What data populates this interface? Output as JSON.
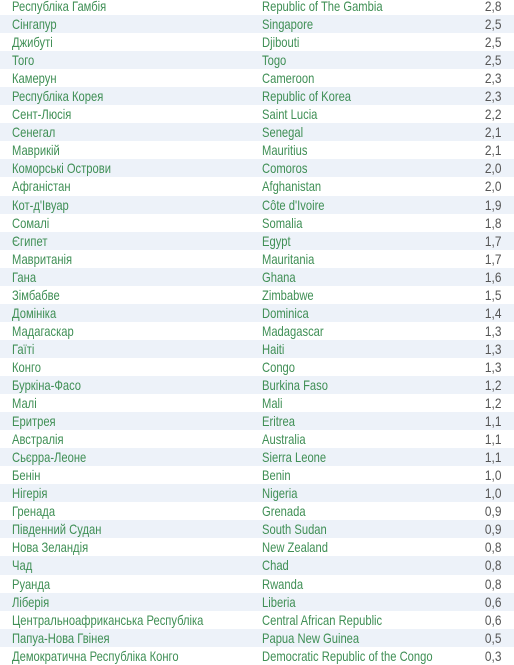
{
  "colors": {
    "text_green": "#3f8f55",
    "value_gray": "#555555",
    "stripe": "#edf2f9"
  },
  "rows": [
    {
      "uk": "Республіка Гамбія",
      "en": "Republic of The Gambia",
      "value": "2,8"
    },
    {
      "uk": "Сінгапур",
      "en": "Singapore",
      "value": "2,5"
    },
    {
      "uk": "Джибуті",
      "en": "Djibouti",
      "value": "2,5"
    },
    {
      "uk": "Того",
      "en": "Togo",
      "value": "2,5"
    },
    {
      "uk": "Камерун",
      "en": "Cameroon",
      "value": "2,3"
    },
    {
      "uk": "Республіка Корея",
      "en": "Republic of Korea",
      "value": "2,3"
    },
    {
      "uk": "Сент-Люсія",
      "en": "Saint Lucia",
      "value": "2,2"
    },
    {
      "uk": "Сенегал",
      "en": "Senegal",
      "value": "2,1"
    },
    {
      "uk": "Маврикій",
      "en": "Mauritius",
      "value": "2,1"
    },
    {
      "uk": "Коморські Острови",
      "en": "Comoros",
      "value": "2,0"
    },
    {
      "uk": "Афганістан",
      "en": "Afghanistan",
      "value": "2,0"
    },
    {
      "uk": "Кот-д'Івуар",
      "en": "Côte d'Ivoire",
      "value": "1,9"
    },
    {
      "uk": "Сомалі",
      "en": "Somalia",
      "value": "1,8"
    },
    {
      "uk": "Єгипет",
      "en": "Egypt",
      "value": "1,7"
    },
    {
      "uk": "Мавританія",
      "en": "Mauritania",
      "value": "1,7"
    },
    {
      "uk": "Гана",
      "en": "Ghana",
      "value": "1,6"
    },
    {
      "uk": "Зімбабве",
      "en": "Zimbabwe",
      "value": "1,5"
    },
    {
      "uk": "Домініка",
      "en": "Dominica",
      "value": "1,4"
    },
    {
      "uk": "Мадагаскар",
      "en": "Madagascar",
      "value": "1,3"
    },
    {
      "uk": "Гаїті",
      "en": "Haiti",
      "value": "1,3"
    },
    {
      "uk": "Конго",
      "en": "Congo",
      "value": "1,3"
    },
    {
      "uk": "Буркіна-Фасо",
      "en": "Burkina Faso",
      "value": "1,2"
    },
    {
      "uk": "Малі",
      "en": "Mali",
      "value": "1,2"
    },
    {
      "uk": "Еритрея",
      "en": "Eritrea",
      "value": "1,1"
    },
    {
      "uk": "Австралія",
      "en": "Australia",
      "value": "1,1"
    },
    {
      "uk": "Сьєрра-Леоне",
      "en": "Sierra Leone",
      "value": "1,1"
    },
    {
      "uk": "Бенін",
      "en": "Benin",
      "value": "1,0"
    },
    {
      "uk": "Нігерія",
      "en": "Nigeria",
      "value": "1,0"
    },
    {
      "uk": "Гренада",
      "en": "Grenada",
      "value": "0,9"
    },
    {
      "uk": "Південний Судан",
      "en": "South Sudan",
      "value": "0,9"
    },
    {
      "uk": "Нова Зеландія",
      "en": "New Zealand",
      "value": "0,8"
    },
    {
      "uk": "Чад",
      "en": "Chad",
      "value": "0,8"
    },
    {
      "uk": "Руанда",
      "en": "Rwanda",
      "value": "0,8"
    },
    {
      "uk": "Ліберія",
      "en": "Liberia",
      "value": "0,6"
    },
    {
      "uk": "Центральноафриканська Республіка",
      "en": "Central African Republic",
      "value": "0,6"
    },
    {
      "uk": "Папуа-Нова Гвінея",
      "en": "Papua New Guinea",
      "value": "0,5"
    },
    {
      "uk": "Демократична Республіка Конго",
      "en": "Democratic Republic of the Congo",
      "value": "0,3"
    }
  ]
}
